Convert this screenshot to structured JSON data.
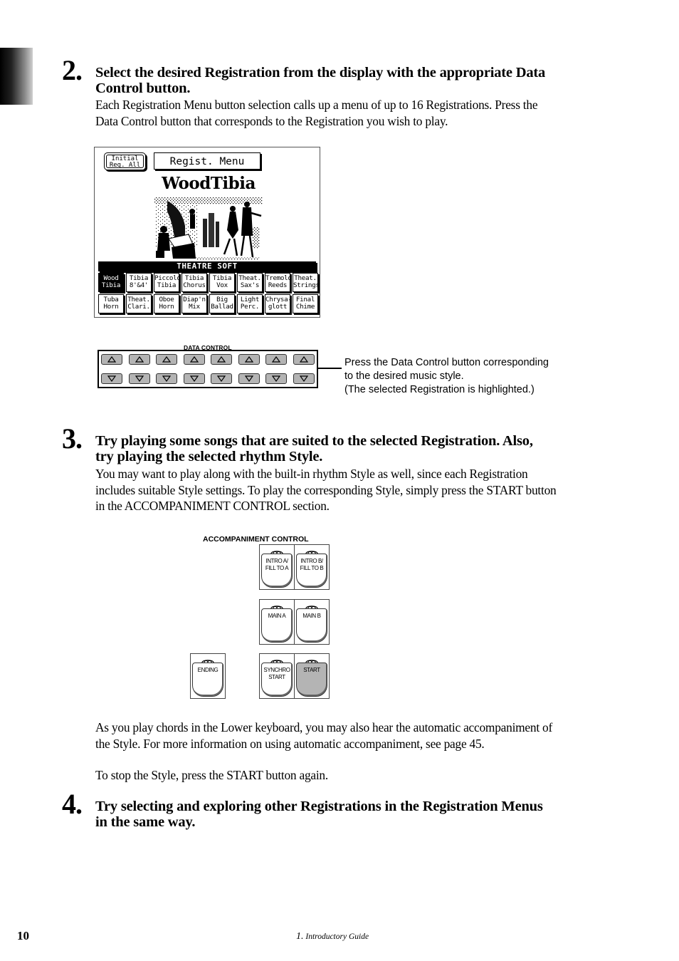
{
  "steps": [
    {
      "number": "2.",
      "heading_line1": "Select the desired Registration from the display with the appropriate Data",
      "heading_line2": "Control button.",
      "body_line1": "Each Registration Menu button selection calls up a menu of up to 16 Registrations.  Press the",
      "body_line2": "Data Control button that corresponds to the Registration you wish to play."
    },
    {
      "number": "3.",
      "heading_line1": "Try playing some songs that are suited to the selected Registration.  Also,",
      "heading_line2": "try playing the selected rhythm Style.",
      "body_line1": "You may want to play along with the built-in rhythm Style as well, since each Registration",
      "body_line2": "includes suitable Style settings.  To play the corresponding Style, simply press the START button",
      "body_line3": "in the ACCOMPANIMENT CONTROL section.",
      "after_line1": "As you play chords in the Lower keyboard, you may also hear the automatic accompaniment of",
      "after_line2": "the Style.  For more information on using automatic accompaniment, see page 45.",
      "after_line3": "To stop the Style, press the START button again."
    },
    {
      "number": "4.",
      "heading_line1": "Try selecting and exploring other Registrations in the Registration Menus",
      "heading_line2": "in the same way."
    }
  ],
  "lcd": {
    "initial_button_line1": "Initial",
    "initial_button_line2": "Reg. All",
    "menu_title": "Regist. Menu",
    "registration_name": "WoodTibia",
    "illustration": "theatre-organ-scene",
    "bank_name": "THEATRE SOFT",
    "registrations": [
      {
        "label": "Wood\nTibia",
        "selected": true
      },
      {
        "label": "Tibia\n8'&4'",
        "selected": false
      },
      {
        "label": "Piccolo\nTibia",
        "selected": false
      },
      {
        "label": "Tibia\nChorus",
        "selected": false
      },
      {
        "label": "Tibia\nVox",
        "selected": false
      },
      {
        "label": "Theat.\nSax's",
        "selected": false
      },
      {
        "label": "Tremolo\nReeds",
        "selected": false
      },
      {
        "label": "Theat.\nStrings",
        "selected": false
      },
      {
        "label": "Tuba\nHorn",
        "selected": false
      },
      {
        "label": "Theat.\nClari.",
        "selected": false
      },
      {
        "label": "Oboe\nHorn",
        "selected": false
      },
      {
        "label": "Diap'n\nMix",
        "selected": false
      },
      {
        "label": "Big\nBallad",
        "selected": false
      },
      {
        "label": "Light\nPerc.",
        "selected": false
      },
      {
        "label": "Chrysa-\nglott",
        "selected": false
      },
      {
        "label": "Final\nChime",
        "selected": false
      }
    ]
  },
  "data_control": {
    "label": "DATA CONTROL",
    "columns": 8,
    "up_icon": "triangle-up-icon",
    "down_icon": "triangle-down-icon",
    "callout_line1": "Press the Data Control button corresponding",
    "callout_line2": "to the desired music style.",
    "callout_line3": "(The selected Registration is highlighted.)"
  },
  "accompaniment": {
    "label": "ACCOMPANIMENT CONTROL",
    "buttons": {
      "intro_a": {
        "label": "INTRO A/\nFILL TO A",
        "on": false
      },
      "intro_b": {
        "label": "INTRO B/\nFILL TO B",
        "on": false
      },
      "main_a": {
        "label": "MAIN A",
        "on": false
      },
      "main_b": {
        "label": "MAIN B",
        "on": false
      },
      "ending": {
        "label": "ENDING",
        "on": false
      },
      "synchro_start": {
        "label": "SYNCHRO\nSTART",
        "on": false
      },
      "start": {
        "label": "START",
        "on": true
      }
    },
    "highlight_color": "#b4b4b4"
  },
  "footer": {
    "page_number": "10",
    "chapter_number": "1.",
    "chapter_title": "Introductory Guide"
  }
}
